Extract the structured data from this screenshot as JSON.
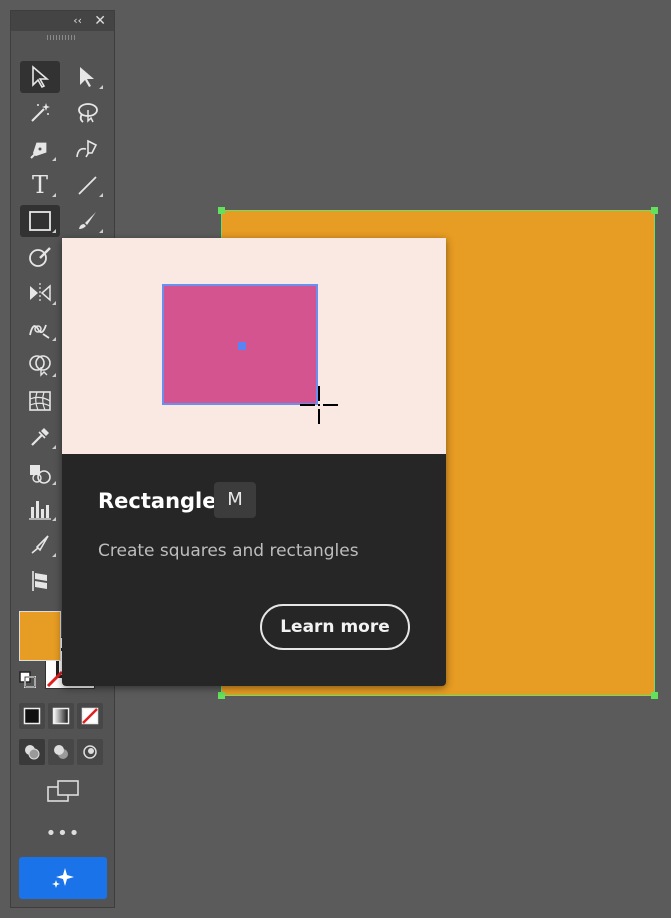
{
  "toolbar": {
    "collapse_label": "‹‹",
    "close_label": "✕",
    "tools": [
      {
        "name": "selection-tool",
        "icon": "selection-arrow-icon"
      },
      {
        "name": "direct-selection-tool",
        "icon": "direct-selection-arrow-icon"
      },
      {
        "name": "magic-wand-tool",
        "icon": "magic-wand-icon"
      },
      {
        "name": "lasso-tool",
        "icon": "lasso-icon"
      },
      {
        "name": "pen-tool",
        "icon": "pen-icon"
      },
      {
        "name": "curvature-tool",
        "icon": "curvature-pen-icon"
      },
      {
        "name": "type-tool",
        "icon": "type-icon",
        "glyph": "T"
      },
      {
        "name": "line-segment-tool",
        "icon": "line-icon"
      },
      {
        "name": "rectangle-tool",
        "icon": "rectangle-icon"
      },
      {
        "name": "paintbrush-tool",
        "icon": "paintbrush-icon"
      },
      {
        "name": "shaper-tool",
        "icon": "shaper-icon"
      },
      {
        "name": "reflect-tool",
        "icon": "reflect-icon"
      },
      {
        "name": "warp-tool",
        "icon": "warp-icon"
      },
      {
        "name": "shape-builder-tool",
        "icon": "shape-builder-icon"
      },
      {
        "name": "mesh-tool",
        "icon": "mesh-icon"
      },
      {
        "name": "eyedropper-tool",
        "icon": "eyedropper-icon"
      },
      {
        "name": "symbol-sprayer-tool",
        "icon": "symbol-sprayer-icon"
      },
      {
        "name": "column-graph-tool",
        "icon": "column-graph-icon"
      },
      {
        "name": "slice-tool",
        "icon": "slice-icon"
      },
      {
        "name": "artboard-tool",
        "icon": "artboard-icon"
      }
    ],
    "fill_color": "#e79c23",
    "stroke_color": "#ffffff"
  },
  "artboard": {
    "fill_color": "#e79c23",
    "selection_color": "#63e05c"
  },
  "tooltip": {
    "title": "Rectangle",
    "shortcut": "M",
    "description": "Create squares and rectangles",
    "learn_more_label": "Learn more",
    "illustration": {
      "background": "#fae8e3",
      "shape_color": "#d3548f",
      "selection_color": "#6b8ff0"
    }
  },
  "more_label": "•••"
}
